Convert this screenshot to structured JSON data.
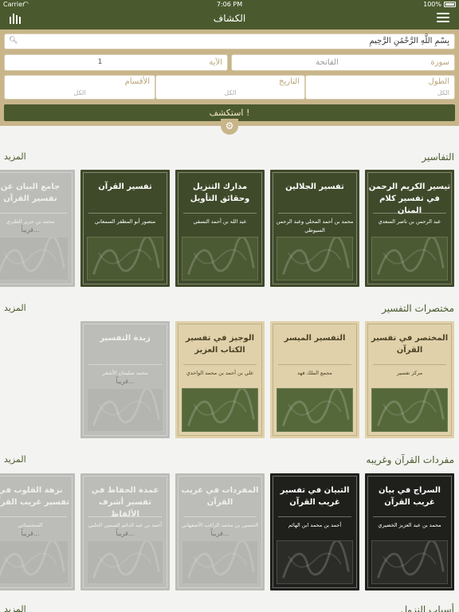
{
  "status": {
    "carrier": "Carrier",
    "time": "7:06 PM",
    "battery": "100%"
  },
  "nav": {
    "title": "الكشاف"
  },
  "search": {
    "value": "بِسْمِ اللَّهِ الرَّحْمَٰنِ الرَّحِيمِ",
    "surah_label": "سورة",
    "surah_value": "الفاتحة",
    "ayah_label": "الآية",
    "ayah_value": "1",
    "length_label": "الطول",
    "length_value": "الكل",
    "history_label": "التاريخ",
    "history_value": "الكل",
    "parts_label": "الأقسام",
    "parts_value": "الكل",
    "button": "استكشف !"
  },
  "sections": [
    {
      "title": "التفاسير",
      "more": "المزيد",
      "cards": [
        {
          "title": "تيسير الكريم الرحمن في تفسير كلام المنان",
          "author": "عبد الرحمن بن ناصر السعدي",
          "style": "dark"
        },
        {
          "title": "تفسير الجلالين",
          "author": "محمد بن أحمد المحلي وعبد الرحمن السيوطي",
          "style": "dark"
        },
        {
          "title": "مدارك التنزيل وحقائق التأويل",
          "author": "عبد الله بن أحمد النسفي",
          "style": "dark"
        },
        {
          "title": "تفسير القرآن",
          "author": "منصور أبو المظفر السمعاني",
          "style": "dark"
        },
        {
          "title": "جامع البيان عن تفسير القرآن",
          "author": "محمد بن جرير الطبري",
          "style": "gray",
          "soon": "قريباً..."
        }
      ]
    },
    {
      "title": "مختصرات التفسير",
      "more": "المزيد",
      "cards": [
        {
          "title": "المختصر في تفسير القرآن",
          "author": "مركز تفسير",
          "style": "beige"
        },
        {
          "title": "التفسير الميسر",
          "author": "مجمع الملك فهد",
          "style": "beige"
        },
        {
          "title": "الوجيز في تفسير الكتاب العزيز",
          "author": "علي بن أحمد بن محمد الواحدي",
          "style": "beige"
        },
        {
          "title": "زبدة التفسير",
          "author": "محمد سليمان الأشقر",
          "style": "gray",
          "soon": "قريباً..."
        }
      ]
    },
    {
      "title": "مفردات القرآن وغريبه",
      "more": "المزيد",
      "cards": [
        {
          "title": "السراج في بيان غريب القرآن",
          "author": "محمد بن عبد العزيز الخضيري",
          "style": "black"
        },
        {
          "title": "التبيان في تفسير غريب القرآن",
          "author": "أحمد بن محمد ابن الهائم",
          "style": "black"
        },
        {
          "title": "المفردات في غريب القرآن",
          "author": "الحسين بن محمد الراغب الأصفهاني",
          "style": "gray",
          "soon": "قريباً..."
        },
        {
          "title": "عمدة الحفاظ في تفسير أشرف الألفاظ",
          "author": "أحمد بن عبد الدائم السمين الحلبي",
          "style": "gray",
          "soon": "قريباً..."
        },
        {
          "title": "نزهة القلوب في تفسير غريب القرآن",
          "author": "السجستاني",
          "style": "gray",
          "soon": "قريباً..."
        }
      ]
    },
    {
      "title": "أسباب النزول",
      "more": "المزيد",
      "cards": []
    }
  ],
  "colors": {
    "primary": "#4b5a2e",
    "panel": "#c8b58a"
  }
}
